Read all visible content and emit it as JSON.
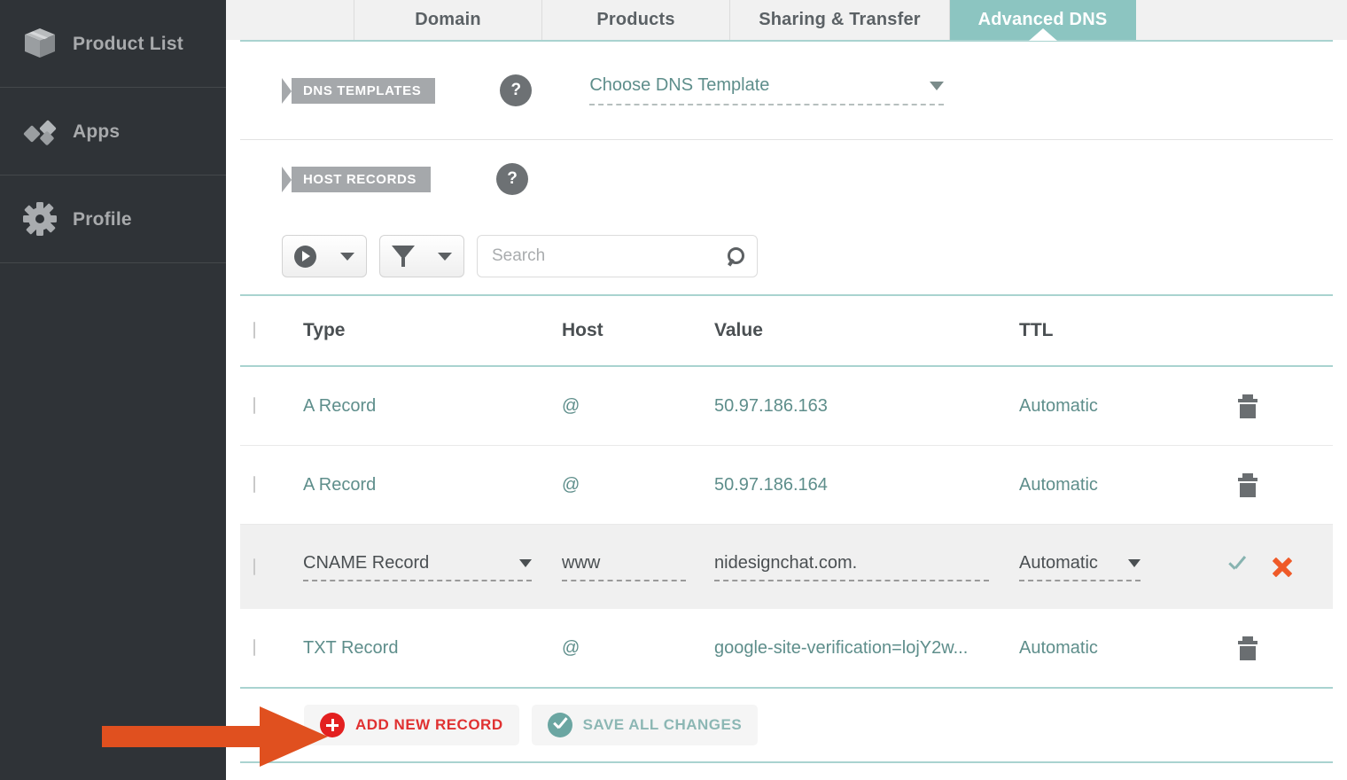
{
  "sidebar": {
    "items": [
      {
        "label": "Product List",
        "icon": "box-icon"
      },
      {
        "label": "Apps",
        "icon": "apps-diamond-icon"
      },
      {
        "label": "Profile",
        "icon": "gear-icon"
      }
    ]
  },
  "tabs": [
    {
      "label": "",
      "active": false
    },
    {
      "label": "Domain",
      "active": false
    },
    {
      "label": "Products",
      "active": false
    },
    {
      "label": "Sharing & Transfer",
      "active": false
    },
    {
      "label": "Advanced DNS",
      "active": true
    }
  ],
  "dns_templates": {
    "section_label": "DNS TEMPLATES",
    "help_label": "?",
    "select_value": "Choose DNS Template"
  },
  "host_records": {
    "section_label": "HOST RECORDS",
    "help_label": "?"
  },
  "toolbar": {
    "action_menu_icon": "play-circle-icon",
    "filter_menu_icon": "funnel-icon",
    "search_placeholder": "Search",
    "search_value": "",
    "search_icon": "search-icon"
  },
  "table": {
    "columns": [
      "Type",
      "Host",
      "Value",
      "TTL"
    ],
    "rows": [
      {
        "type": "A Record",
        "host": "@",
        "value": "50.97.186.163",
        "ttl": "Automatic",
        "editing": false,
        "delete_icon": "trash-icon"
      },
      {
        "type": "A Record",
        "host": "@",
        "value": "50.97.186.164",
        "ttl": "Automatic",
        "editing": false,
        "delete_icon": "trash-icon"
      },
      {
        "type": "CNAME Record",
        "host": "www",
        "value": "nidesignchat.com.",
        "ttl": "Automatic",
        "editing": true,
        "confirm_icon": "check-icon",
        "cancel_icon": "x-icon"
      },
      {
        "type": "TXT Record",
        "host": "@",
        "value": "google-site-verification=lojY2w...",
        "ttl": "Automatic",
        "editing": false,
        "delete_icon": "trash-icon"
      }
    ]
  },
  "actions": {
    "add_label": "ADD NEW RECORD",
    "add_icon": "plus-circle-icon",
    "save_label": "SAVE ALL CHANGES",
    "save_icon": "check-circle-icon"
  },
  "annotation": {
    "shape": "right-arrow",
    "color": "#e0501f"
  },
  "colors": {
    "accent_teal": "#8cc5c1",
    "link_teal": "#5e8e8b",
    "sidebar_bg": "#2f3337",
    "danger_red": "#e32020",
    "annotation_orange": "#e0501f"
  }
}
